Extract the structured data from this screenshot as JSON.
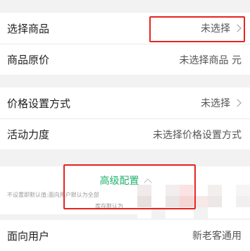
{
  "product_group": {
    "select_product": {
      "label": "选择商品",
      "value": "未选择"
    },
    "original_price": {
      "label": "商品原价",
      "value": "未选择商品 元"
    }
  },
  "price_group": {
    "price_method": {
      "label": "价格设置方式",
      "value": "未选择"
    },
    "discount": {
      "label": "活动力度",
      "value": "未选择价格设置方式"
    }
  },
  "advanced": {
    "title": "高级配置",
    "desc_line1": "不设置即默认值:面向用户默认为全部",
    "desc_line2": "库存默认为"
  },
  "target_users": {
    "label": "面向用户",
    "value": "新老客通用"
  },
  "colors": {
    "accent_green": "#1fb26b",
    "highlight_red": "#e52520",
    "background": "#f2f2f2"
  },
  "icons": {
    "row_chevron": "chevron-right-icon",
    "advanced_chevron": "chevron-up-icon"
  }
}
